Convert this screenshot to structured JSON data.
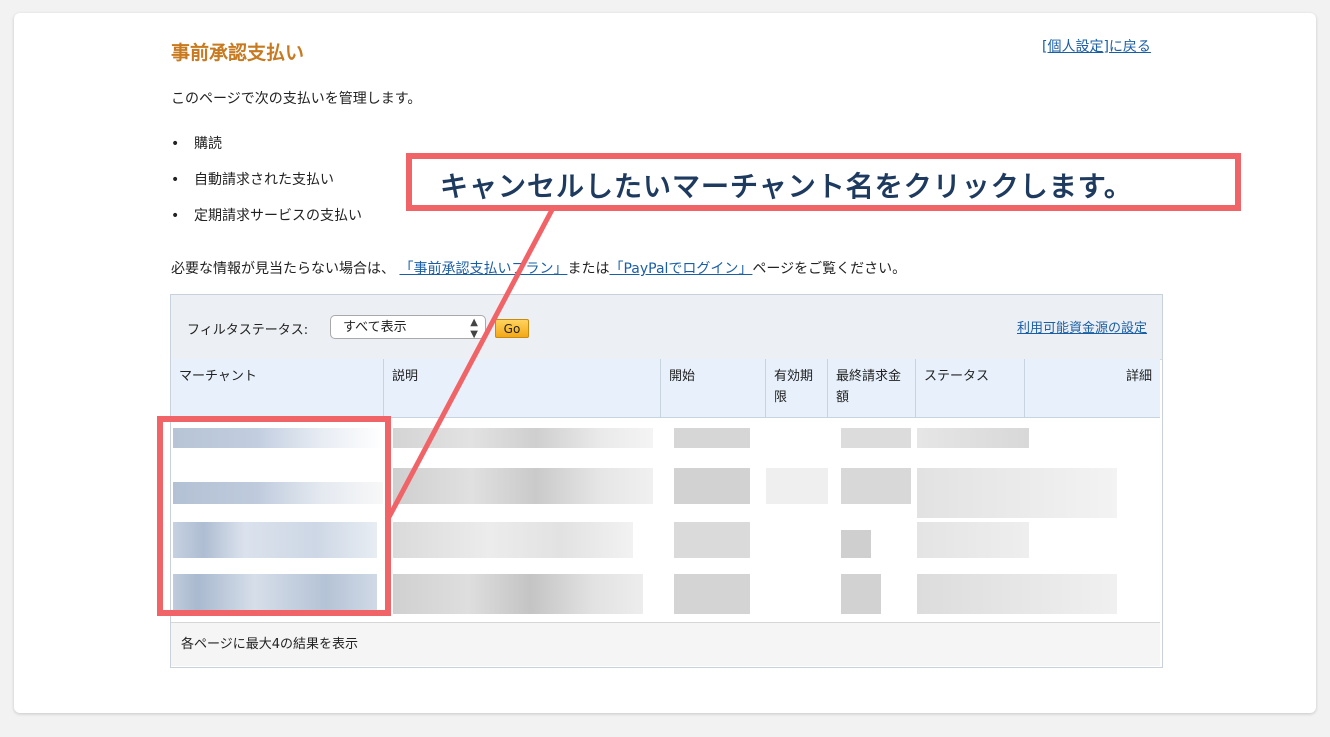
{
  "page": {
    "title": "事前承認支払い",
    "back_link": "[個人設定]に戻る",
    "intro": "このページで次の支払いを管理します。",
    "bullets": [
      "購読",
      "自動請求された支払い",
      "定期請求サービスの支払い"
    ],
    "info_prefix": "必要な情報が見当たらない場合は、",
    "info_link1": "「事前承認支払いプラン」",
    "info_middle": "または",
    "info_link2": "「PayPalでログイン」",
    "info_suffix": "ページをご覧ください。"
  },
  "filter": {
    "label": "フィルタステータス:",
    "selected": "すべて表示",
    "go_label": "Go",
    "funding_link": "利用可能資金源の設定"
  },
  "table": {
    "headers": {
      "merchant": "マーチャント",
      "description": "説明",
      "start": "開始",
      "expiry": "有効期限",
      "last_amount": "最終請求金額",
      "status": "ステータス",
      "details": "詳細"
    },
    "footer": "各ページに最大4の結果を表示"
  },
  "annotation": {
    "callout": "キャンセルしたいマーチャント名をクリックします。",
    "accent_color": "#f06367"
  }
}
